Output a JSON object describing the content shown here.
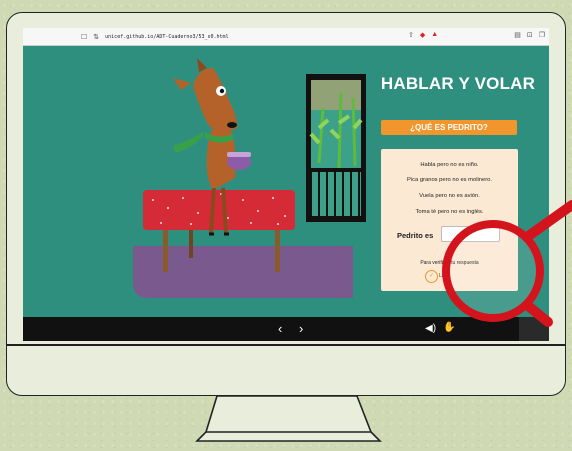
{
  "browser": {
    "url": "unicef.github.io/ADT-Cuaderno3/53_s0.html",
    "icons": [
      "sidebar-icon",
      "settings-icon",
      "share-icon",
      "brave-shield-icon",
      "warning-icon",
      "reader-icon",
      "extensions-icon",
      "window-icon"
    ]
  },
  "page": {
    "title": "HABLAR Y VOLAR",
    "question_button": "¿QUÉ ES PEDRITO?",
    "riddle_lines": [
      "Habla pero no es niño.",
      "Pica granos pero no es molinero.",
      "Vuela pero no es avión.",
      "Toma té pero no es inglés."
    ],
    "answer_label": "Pedrito es",
    "answer_value": "",
    "verify_text": "Para verificar tu respuesta",
    "ok_label": "Listo"
  },
  "nav": {
    "prev": "‹",
    "next": "›",
    "audio": "◀)",
    "sign": "✋"
  },
  "colors": {
    "teal": "#2f8f7f",
    "orange": "#f0962c",
    "card": "#fbe9d3",
    "magnifier": "#d4141c"
  }
}
